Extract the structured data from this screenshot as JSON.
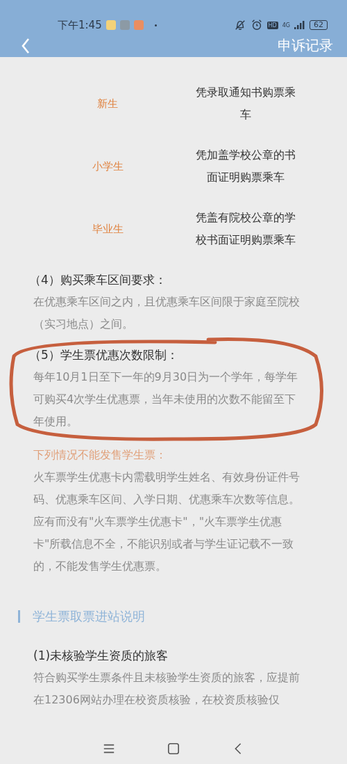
{
  "status_bar": {
    "time": "下午1:45",
    "hd": "HD",
    "network": "4G",
    "battery": "62"
  },
  "header": {
    "title": "申诉记录"
  },
  "table": [
    {
      "label": "新生",
      "text": "凭录取通知书购票乘车"
    },
    {
      "label": "小学生",
      "text": "凭加盖学校公章的书面证明购票乘车"
    },
    {
      "label": "毕业生",
      "text": "凭盖有院校公章的学校书面证明购票乘车"
    }
  ],
  "blocks": [
    {
      "kind": "heading",
      "text": "（4）购买乘车区间要求："
    },
    {
      "kind": "paragraph",
      "text": "在优惠乘车区间之内，且优惠乘车区间限于家庭至院校（实习地点）之间。"
    },
    {
      "kind": "heading",
      "text": "（5）学生票优惠次数限制："
    },
    {
      "kind": "paragraph",
      "text": "每年10月1日至下一年的9月30日为一个学年，每学年可购买4次学生优惠票，当年未使用的次数不能留至下年使用。"
    },
    {
      "kind": "warning",
      "text": "下列情况不能发售学生票："
    },
    {
      "kind": "paragraph",
      "text": "火车票学生优惠卡内需载明学生姓名、有效身份证件号码、优惠乘车区间、入学日期、优惠乘车次数等信息。应有而没有\"火车票学生优惠卡\"，\"火车票学生优惠卡\"所载信息不全，不能识别或者与学生证记载不一致的，不能发售学生优惠票。"
    },
    {
      "kind": "section_title",
      "text": "学生票取票进站说明"
    },
    {
      "kind": "subheading",
      "text": "(1)未核验学生资质的旅客"
    },
    {
      "kind": "paragraph",
      "text": "符合购买学生票条件且未核验学生资质的旅客，应提前在12306网站办理在校资质核验，在校资质核验仅"
    }
  ]
}
